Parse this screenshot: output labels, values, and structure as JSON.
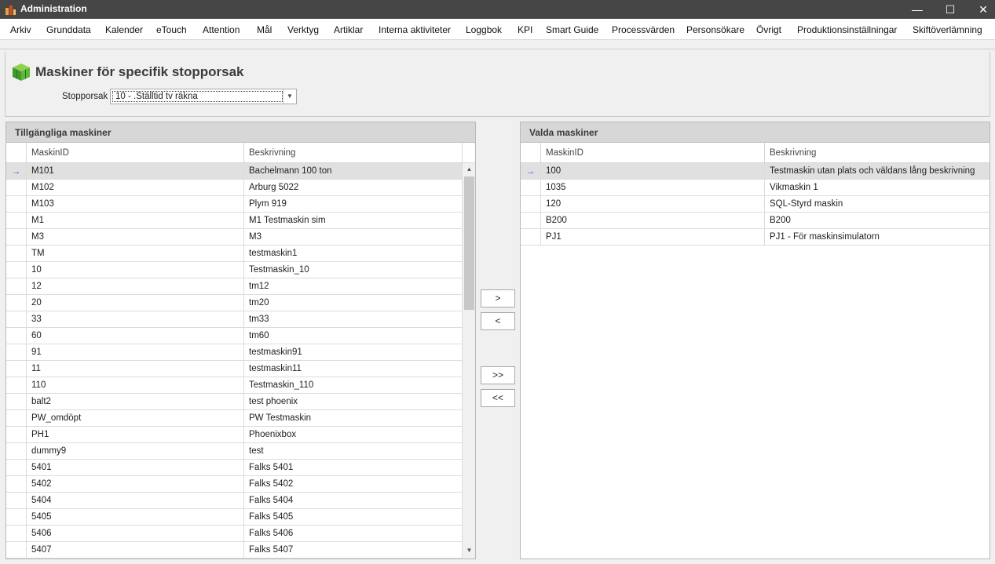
{
  "window": {
    "title": "Administration",
    "minimize": "—",
    "maximize": "☐",
    "close": "✕"
  },
  "menu": [
    "Arkiv",
    "Grunddata",
    "Kalender",
    "eTouch",
    "Attention",
    "Mål",
    "Verktyg",
    "Artiklar",
    "Interna aktiviteter",
    "Loggbok",
    "KPI",
    "Smart Guide",
    "Processvärden",
    "Personsökare",
    "Övrigt",
    "Produktionsinställningar",
    "Skiftöverlämning"
  ],
  "page": {
    "title": "Maskiner för specifik stopporsak"
  },
  "filter": {
    "label": "Stopporsak",
    "value": "10 - .Ställtid tv räkna"
  },
  "available": {
    "title": "Tillgängliga maskiner",
    "columns": [
      "MaskinID",
      "Beskrivning"
    ],
    "rows": [
      [
        "M101",
        "Bachelmann 100 ton"
      ],
      [
        "M102",
        "Arburg 5022"
      ],
      [
        "M103",
        "Plym 919"
      ],
      [
        "M1",
        "M1 Testmaskin sim"
      ],
      [
        "M3",
        "M3"
      ],
      [
        "TM",
        "testmaskin1"
      ],
      [
        "10",
        "Testmaskin_10"
      ],
      [
        "12",
        "tm12"
      ],
      [
        "20",
        "tm20"
      ],
      [
        "33",
        "tm33"
      ],
      [
        "60",
        "tm60"
      ],
      [
        "91",
        "testmaskin91"
      ],
      [
        "11",
        "testmaskin11"
      ],
      [
        "110",
        "Testmaskin_110"
      ],
      [
        "balt2",
        "test phoenix"
      ],
      [
        "PW_omdöpt",
        "PW Testmaskin"
      ],
      [
        "PH1",
        "Phoenixbox"
      ],
      [
        "dummy9",
        "test"
      ],
      [
        "5401",
        "Falks 5401"
      ],
      [
        "5402",
        "Falks 5402"
      ],
      [
        "5404",
        "Falks 5404"
      ],
      [
        "5405",
        "Falks 5405"
      ],
      [
        "5406",
        "Falks 5406"
      ],
      [
        "5407",
        "Falks 5407"
      ]
    ]
  },
  "selected": {
    "title": "Valda maskiner",
    "columns": [
      "MaskinID",
      "Beskrivning"
    ],
    "rows": [
      [
        "100",
        "Testmaskin utan plats och väldans lång beskrivning"
      ],
      [
        "1035",
        "Vikmaskin 1"
      ],
      [
        "120",
        "SQL-Styrd maskin"
      ],
      [
        "B200",
        "B200"
      ],
      [
        "PJ1",
        "PJ1 - För maskinsimulatorn"
      ]
    ]
  },
  "buttons": {
    "add": ">",
    "remove": "<",
    "add_all": ">>",
    "remove_all": "<<"
  },
  "icons": {
    "row_indicator": "→",
    "scroll_up": "▲",
    "scroll_down": "▼",
    "dropdown": "▼"
  }
}
